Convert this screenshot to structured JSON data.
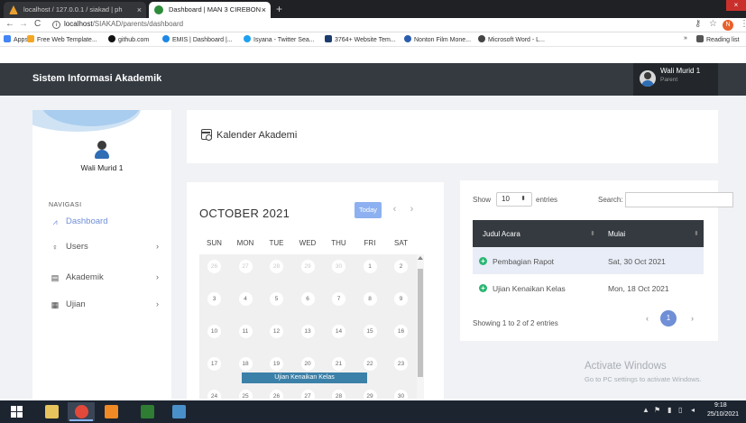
{
  "browser": {
    "tabs": [
      {
        "title": "localhost / 127.0.0.1 / siakad | ph"
      },
      {
        "title": "Dashboard | MAN 3 CIREBON"
      }
    ],
    "new_tab": "+",
    "close_glyph": "×",
    "url_host": "localhost",
    "url_path": "/SIAKAD/parents/dashboard",
    "profile_initial": "N",
    "bookmarks": [
      "Apps",
      "Free Web Template...",
      "github.com",
      "EMIS | Dashboard |...",
      "Isyana - Twitter Sea...",
      "3764+ Website Tem...",
      "Nonton Film Mone...",
      "Microsoft Word - L..."
    ],
    "more_bookmarks": "»",
    "reading_list": "Reading list"
  },
  "app": {
    "brand": "Sistem Informasi Akademik",
    "user_name": "Wali Murid 1",
    "user_role": "Parent"
  },
  "sidebar": {
    "name": "Wali Murid 1",
    "nav_heading": "NAVIGASI",
    "items": [
      {
        "label": "Dashboard",
        "icon": "dashboard-icon"
      },
      {
        "label": "Users",
        "icon": "user-icon"
      },
      {
        "label": "Akademik",
        "icon": "keyboard-icon"
      },
      {
        "label": "Ujian",
        "icon": "calendar-icon"
      }
    ],
    "arrow": "›"
  },
  "page": {
    "title": "Kalender Akademi"
  },
  "calendar": {
    "month": "OCTOBER 2021",
    "today_label": "Today",
    "prev": "‹",
    "next": "›",
    "days_of_week": [
      "SUN",
      "MON",
      "TUE",
      "WED",
      "THU",
      "FRI",
      "SAT"
    ],
    "weeks": [
      [
        "26",
        "27",
        "28",
        "29",
        "30",
        "1",
        "2"
      ],
      [
        "3",
        "4",
        "5",
        "6",
        "7",
        "8",
        "9"
      ],
      [
        "10",
        "11",
        "12",
        "13",
        "14",
        "15",
        "16"
      ],
      [
        "17",
        "18",
        "19",
        "20",
        "21",
        "22",
        "23"
      ],
      [
        "24",
        "25",
        "26",
        "27",
        "28",
        "29",
        "30"
      ]
    ],
    "event": "Ujian Kenaikan Kelas"
  },
  "table": {
    "show_label": "Show",
    "entries_value": "10",
    "entries_label": "entries",
    "search_label": "Search:",
    "headers": [
      "Judul Acara",
      "Mulai"
    ],
    "rows": [
      {
        "title": "Pembagian Rapot",
        "start": "Sat, 30 Oct 2021"
      },
      {
        "title": "Ujian Kenaikan Kelas",
        "start": "Mon, 18 Oct 2021"
      }
    ],
    "info": "Showing 1 to 2 of 2 entries",
    "page_prev": "‹",
    "page_current": "1",
    "page_next": "›"
  },
  "watermark": {
    "title": "Activate Windows",
    "subtitle": "Go to PC settings to activate Windows."
  },
  "taskbar": {
    "time": "9:18",
    "date": "25/10/2021"
  }
}
